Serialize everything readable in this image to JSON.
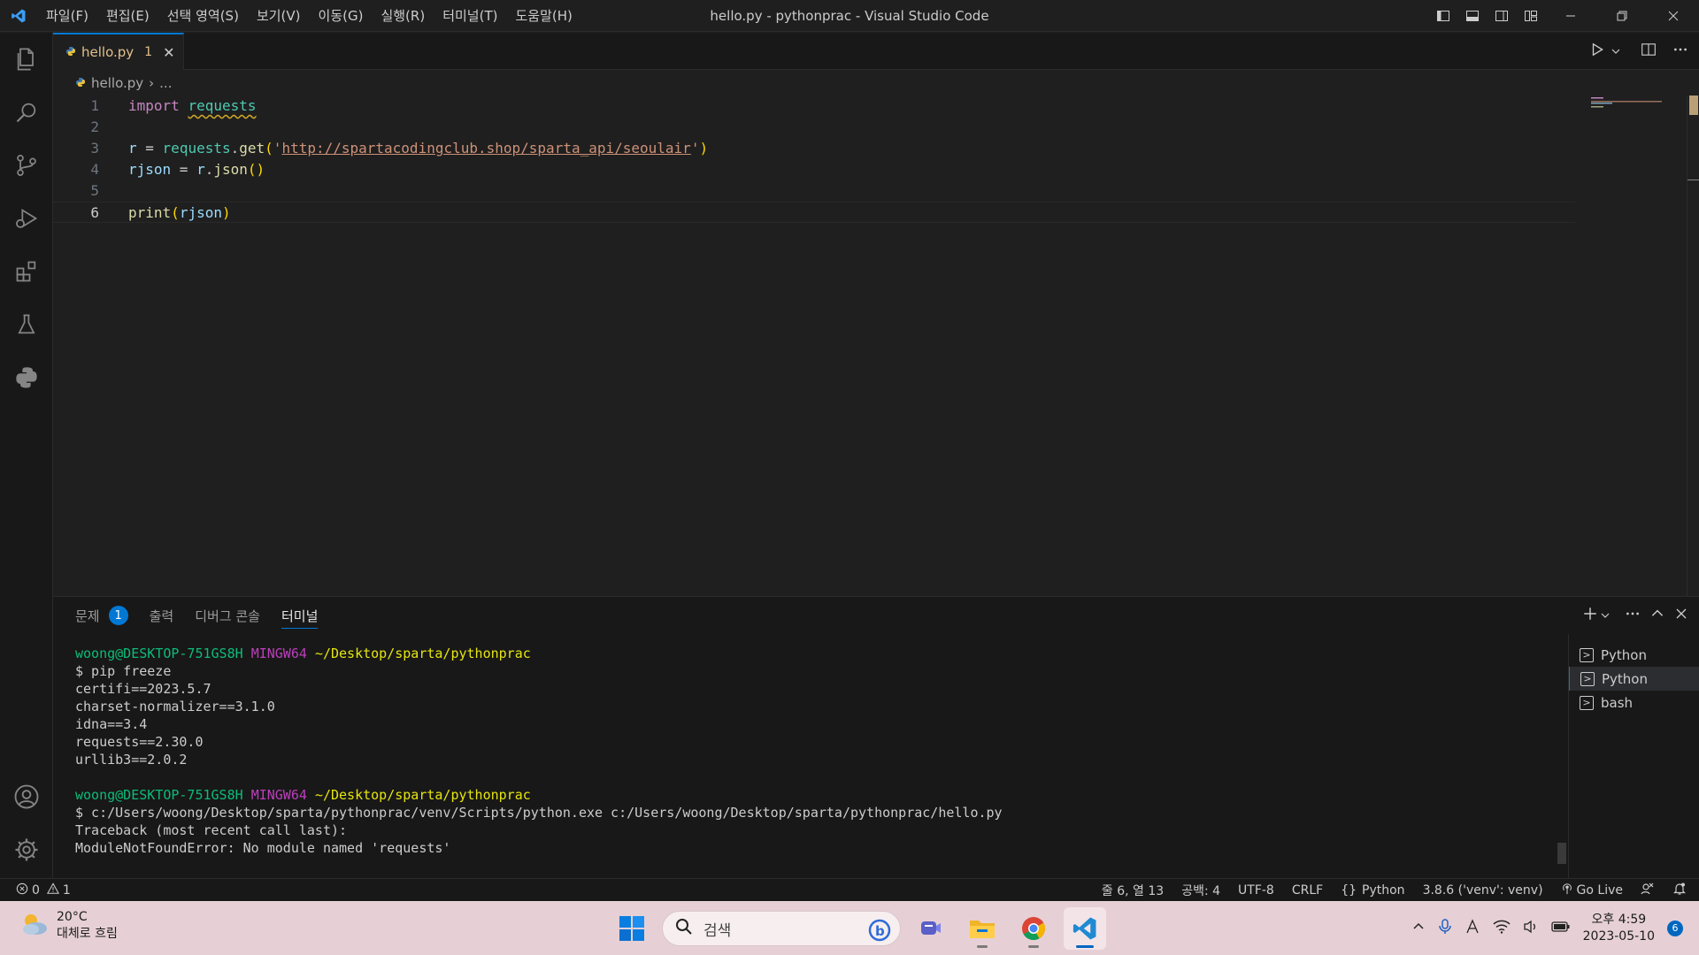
{
  "titlebar": {
    "menus": [
      "파일(F)",
      "편집(E)",
      "선택 영역(S)",
      "보기(V)",
      "이동(G)",
      "실행(R)",
      "터미널(T)",
      "도움말(H)"
    ],
    "title": "hello.py - pythonprac - Visual Studio Code"
  },
  "tab": {
    "name": "hello.py",
    "problems": "1",
    "close": "✕"
  },
  "breadcrumb": {
    "file": "hello.py",
    "sep": "›",
    "rest": "..."
  },
  "editor": {
    "line_numbers": [
      "1",
      "2",
      "3",
      "4",
      "5",
      "6"
    ],
    "l1": {
      "kw": "import",
      "mod": "requests"
    },
    "l3": {
      "var": "r",
      "eq": " = ",
      "obj": "requests",
      "dot": ".",
      "fn": "get",
      "open": "(",
      "q1": "'",
      "url": "http://spartacodingclub.shop/sparta_api/seoulair",
      "q2": "'",
      "close": ")"
    },
    "l4": {
      "var": "rjson",
      "eq": " = ",
      "obj": "r",
      "dot": ".",
      "fn": "json",
      "parens": "()"
    },
    "l6": {
      "fn": "print",
      "open": "(",
      "arg": "rjson",
      "close": ")"
    }
  },
  "panel": {
    "tabs": {
      "problems": "문제",
      "problems_count": "1",
      "output": "출력",
      "debug": "디버그 콘솔",
      "terminal": "터미널"
    },
    "terminal_list": [
      "Python",
      "Python",
      "bash"
    ],
    "terminal": {
      "p1_user": "woong@DESKTOP-751GS8H",
      "p1_sys": "MINGW64",
      "p1_path": "~/Desktop/sparta/pythonprac",
      "cmd1": "$ pip freeze",
      "out1": [
        "certifi==2023.5.7",
        "charset-normalizer==3.1.0",
        "idna==3.4",
        "requests==2.30.0",
        "urllib3==2.0.2"
      ],
      "p2_user": "woong@DESKTOP-751GS8H",
      "p2_sys": "MINGW64",
      "p2_path": "~/Desktop/sparta/pythonprac",
      "cmd2": "$ c:/Users/woong/Desktop/sparta/pythonprac/venv/Scripts/python.exe c:/Users/woong/Desktop/sparta/pythonprac/hello.py",
      "out2": [
        "Traceback (most recent call last):",
        "ModuleNotFoundError: No module named 'requests'"
      ]
    }
  },
  "statusbar": {
    "errors": "0",
    "warnings": "1",
    "position": "줄 6, 열 13",
    "spaces": "공백: 4",
    "encoding": "UTF-8",
    "eol": "CRLF",
    "language": "Python",
    "interpreter": "3.8.6 ('venv': venv)",
    "golive": "Go Live"
  },
  "taskbar": {
    "temp": "20°C",
    "weather": "대체로 흐림",
    "search_placeholder": "검색",
    "time": "오후 4:59",
    "date": "2023-05-10",
    "notifications": "6"
  },
  "colors": {
    "accent": "#0078d4",
    "warning": "#e2c08d"
  }
}
